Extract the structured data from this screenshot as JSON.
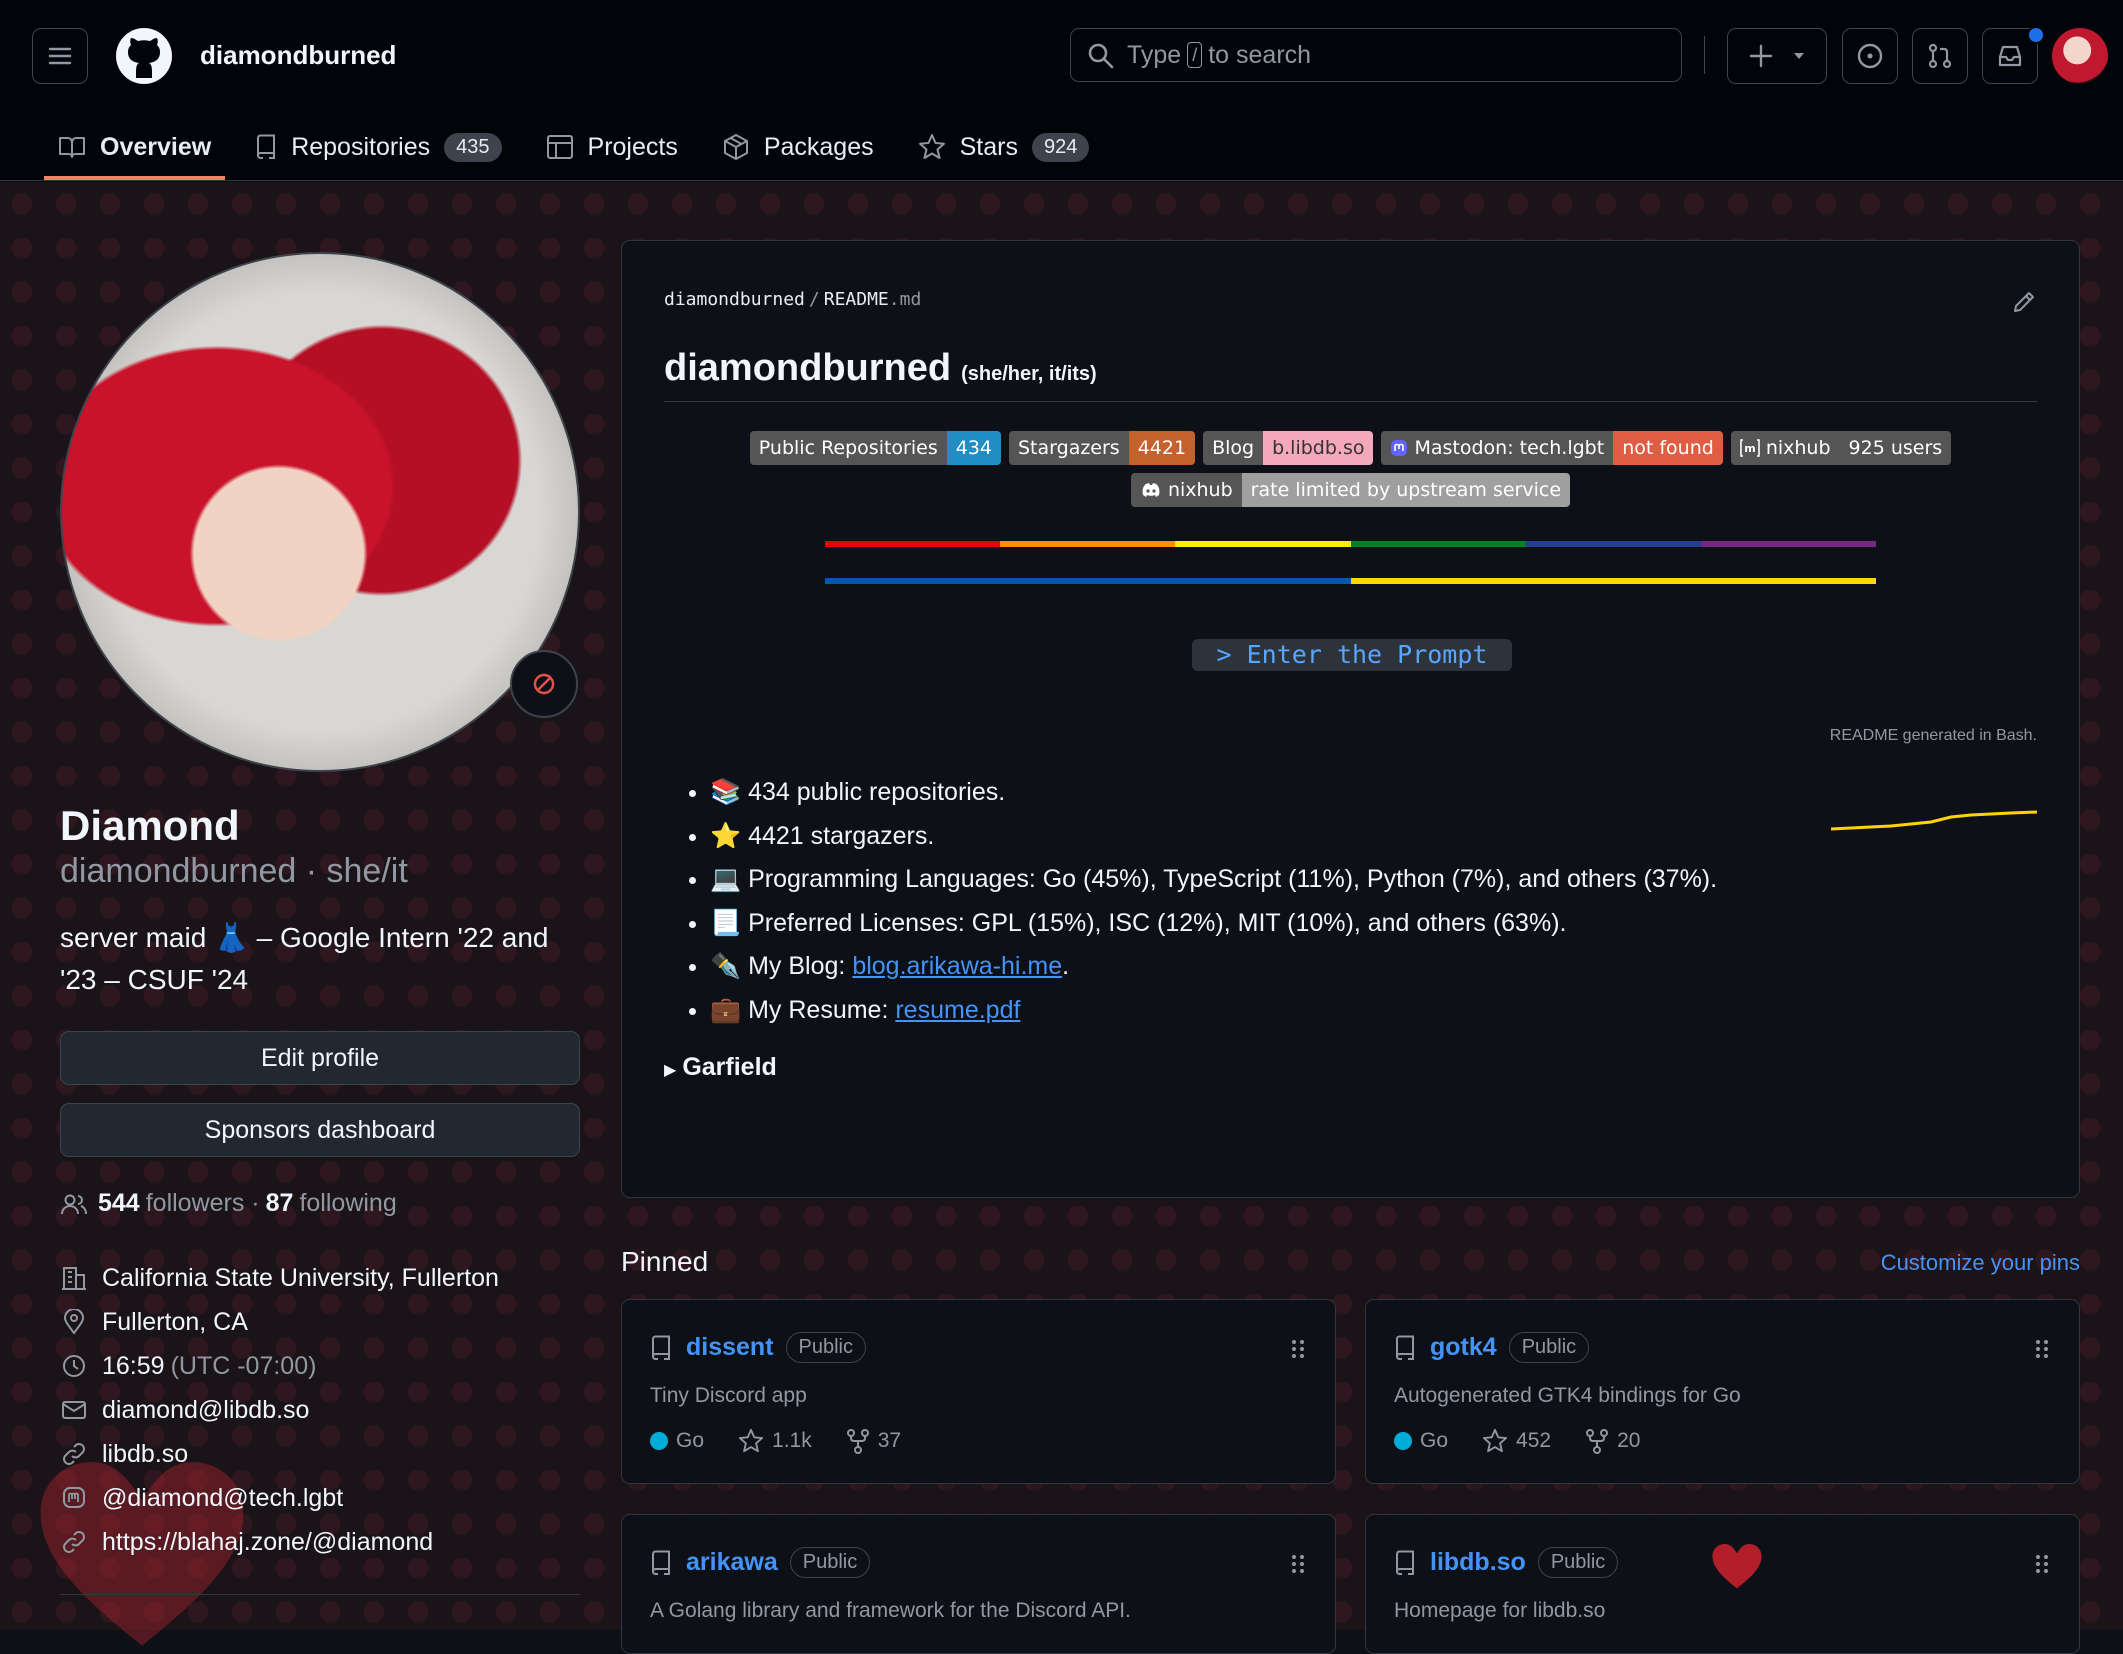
{
  "header": {
    "username": "diamondburned",
    "search_placeholder_before": "Type",
    "search_key": "/",
    "search_placeholder_after": "to search"
  },
  "tabs": [
    {
      "label": "Overview"
    },
    {
      "label": "Repositories",
      "count": "435"
    },
    {
      "label": "Projects"
    },
    {
      "label": "Packages"
    },
    {
      "label": "Stars",
      "count": "924"
    }
  ],
  "profile": {
    "name": "Diamond",
    "login_line": "diamondburned · she/it",
    "bio": "server maid 👗 – Google Intern '22 and '23 – CSUF '24",
    "edit_profile": "Edit profile",
    "sponsors_dashboard": "Sponsors dashboard",
    "followers_count": "544",
    "followers_label": "followers ·",
    "following_count": "87",
    "following_label": "following",
    "organization": "California State University, Fullerton",
    "location": "Fullerton, CA",
    "local_time": "16:59",
    "timezone": "(UTC -07:00)",
    "email": "diamond@libdb.so",
    "website": "libdb.so",
    "mastodon": "@diamond@tech.lgbt",
    "social_link": "https://blahaj.zone/@diamond"
  },
  "readme": {
    "crumb_user": "diamondburned",
    "crumb_sep": "/",
    "crumb_file": "README",
    "crumb_ext": ".md",
    "title": "diamondburned",
    "pronouns": "(she/her, it/its)",
    "badges": [
      {
        "label": "Public Repositories",
        "value": "434",
        "color": "#1f8ec4"
      },
      {
        "label": "Stargazers",
        "value": "4421",
        "color": "#c4612c"
      },
      {
        "label": "Blog",
        "value": "b.libdb.so",
        "color": "#f4a8bb"
      },
      {
        "label": "Mastodon: tech.lgbt",
        "value": "not found",
        "color": "#e05d44"
      },
      {
        "label": "nixhub",
        "value": "925 users",
        "color": "#555555"
      },
      {
        "label": "nixhub",
        "value": "rate limited by upstream service",
        "color": "#9f9f9f"
      }
    ],
    "prompt": "> Enter the Prompt",
    "generated_note": "README generated in Bash.",
    "stats": [
      {
        "emoji": "📚",
        "text": "434 public repositories."
      },
      {
        "emoji": "⭐",
        "text": "4421 stargazers."
      },
      {
        "emoji": "💻",
        "text": "Programming Languages: Go (45%), TypeScript (11%), Python (7%), and others (37%)."
      },
      {
        "emoji": "📃",
        "text": "Preferred Licenses: GPL (15%), ISC (12%), MIT (10%), and others (63%)."
      }
    ],
    "blog_label": "My Blog:",
    "blog_link": "blog.arikawa-hi.me",
    "resume_label": "My Resume:",
    "resume_link": "resume.pdf",
    "details_summary": "Garfield",
    "rainbow_colors": [
      "#e40303",
      "#ff8c00",
      "#ffed00",
      "#008026",
      "#24408e",
      "#732982"
    ],
    "flag_colors": [
      "#0057b7",
      "#ffd700"
    ]
  },
  "pinned": {
    "heading": "Pinned",
    "customize": "Customize your pins",
    "repos": [
      {
        "name": "dissent",
        "visibility": "Public",
        "description": "Tiny Discord app",
        "language": "Go",
        "stars": "1.1k",
        "forks": "37"
      },
      {
        "name": "gotk4",
        "visibility": "Public",
        "description": "Autogenerated GTK4 bindings for Go",
        "language": "Go",
        "stars": "452",
        "forks": "20"
      },
      {
        "name": "arikawa",
        "visibility": "Public",
        "description": "A Golang library and framework for the Discord API."
      },
      {
        "name": "libdb.so",
        "visibility": "Public",
        "description": "Homepage for libdb.so"
      }
    ]
  }
}
